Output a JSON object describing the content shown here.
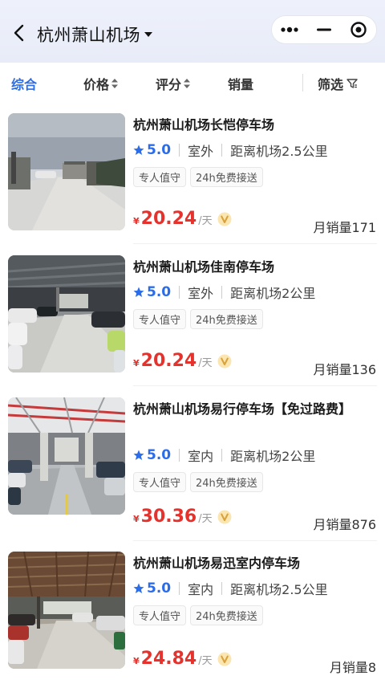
{
  "header": {
    "title": "杭州萧山机场"
  },
  "sortbar": {
    "items": [
      {
        "label": "综合"
      },
      {
        "label": "价格"
      },
      {
        "label": "评分"
      },
      {
        "label": "销量"
      },
      {
        "label": "筛选"
      }
    ]
  },
  "colors": {
    "accent": "#2b6de8",
    "price": "#e5322d",
    "header_bg": "#eef1fb"
  },
  "lots": [
    {
      "name": "杭州萧山机场长恺停车场",
      "score": "5.0",
      "type": "室外",
      "distance": "距离机场2.5公里",
      "tags": [
        "专人值守",
        "24h免费接送"
      ],
      "currency": "¥",
      "price": "20.24",
      "unit": "/天",
      "sales": "月销量171"
    },
    {
      "name": "杭州萧山机场佳南停车场",
      "score": "5.0",
      "type": "室外",
      "distance": "距离机场2公里",
      "tags": [
        "专人值守",
        "24h免费接送"
      ],
      "currency": "¥",
      "price": "20.24",
      "unit": "/天",
      "sales": "月销量136"
    },
    {
      "name": "杭州萧山机场易行停车场【免过路费】",
      "score": "5.0",
      "type": "室内",
      "distance": "距离机场2公里",
      "tags": [
        "专人值守",
        "24h免费接送"
      ],
      "currency": "¥",
      "price": "30.36",
      "unit": "/天",
      "sales": "月销量876"
    },
    {
      "name": "杭州萧山机场易迅室内停车场",
      "score": "5.0",
      "type": "室内",
      "distance": "距离机场2.5公里",
      "tags": [
        "专人值守",
        "24h免费接送"
      ],
      "currency": "¥",
      "price": "24.84",
      "unit": "/天",
      "sales": "月销量8"
    }
  ]
}
